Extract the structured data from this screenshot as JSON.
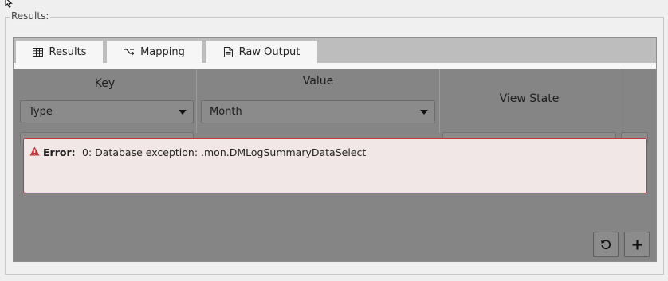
{
  "group": {
    "title": "Results:"
  },
  "tabs": [
    {
      "label": "Results",
      "icon": "table-icon"
    },
    {
      "label": "Mapping",
      "icon": "mapping-icon"
    },
    {
      "label": "Raw Output",
      "icon": "document-icon"
    }
  ],
  "table": {
    "columns": [
      "Key",
      "Value",
      "View State"
    ],
    "filters": {
      "key": {
        "selected": "Type"
      },
      "value": {
        "selected": "Month"
      }
    }
  },
  "error": {
    "label": "Error:",
    "message": "0: Database exception: .mon.DMLogSummaryDataSelect",
    "color": "#c8323a"
  },
  "actions": {
    "refresh_icon": "refresh-icon",
    "add_icon": "plus-icon"
  }
}
